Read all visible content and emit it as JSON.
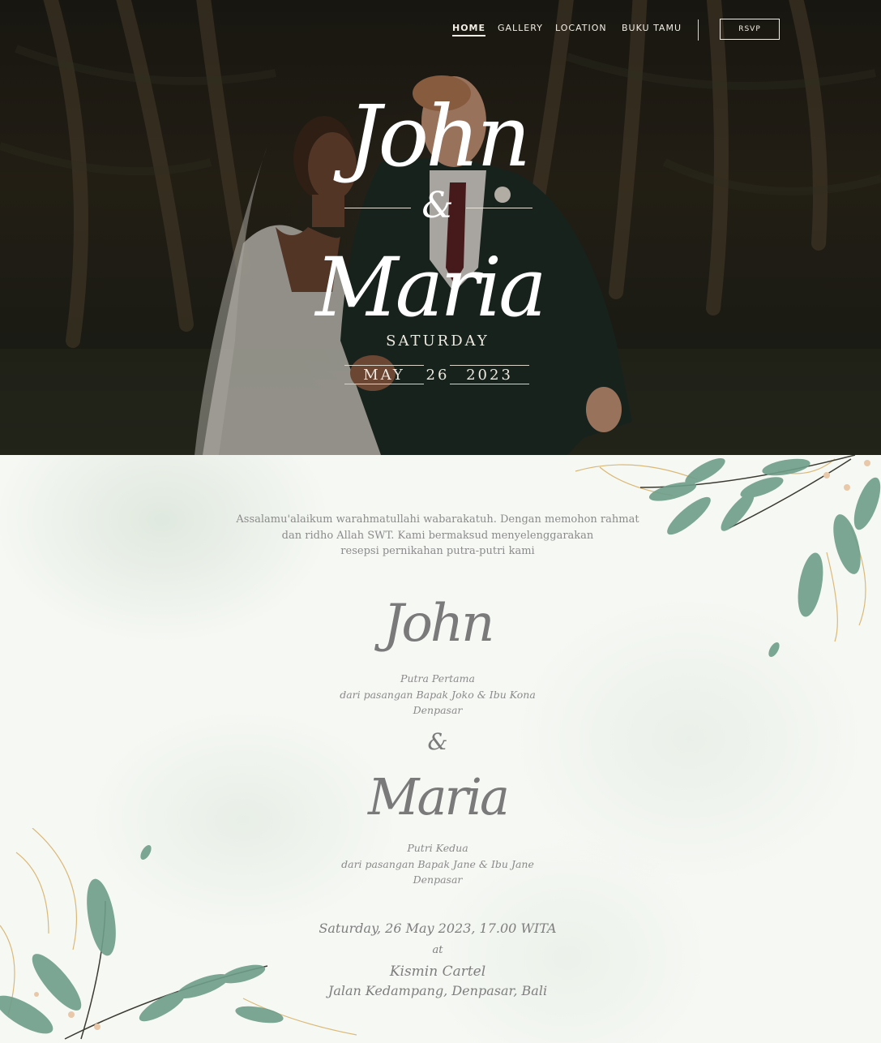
{
  "nav": {
    "items": [
      "HOME",
      "GALLERY",
      "LOCATION",
      "BUKU TAMU"
    ],
    "rsvp_label": "RSVP"
  },
  "hero": {
    "groom": "John",
    "ampersand": "&",
    "bride": "Maria",
    "day": "SATURDAY",
    "month": "MAY",
    "date": "26",
    "year": "2023"
  },
  "invite": {
    "greeting": [
      "Assalamu'alaikum warahmatullahi wabarakatuh. Dengan memohon rahmat",
      "dan ridho Allah SWT. Kami bermaksud menyelenggarakan",
      "resepsi pernikahan putra-putri kami"
    ],
    "groom": {
      "name": "John",
      "lines": [
        "Putra Pertama",
        "dari pasangan Bapak Joko & Ibu Kona",
        "Denpasar"
      ]
    },
    "ampersand": "&",
    "bride": {
      "name": "Maria",
      "lines": [
        "Putri Kedua",
        "dari pasangan Bapak Jane & Ibu Jane",
        "Denpasar"
      ]
    },
    "event": {
      "datetime": "Saturday, 26 May 2023, 17.00 WITA",
      "at": "at",
      "venue": "Kismin Cartel",
      "address": "Jalan Kedampang, Denpasar, Bali"
    }
  }
}
